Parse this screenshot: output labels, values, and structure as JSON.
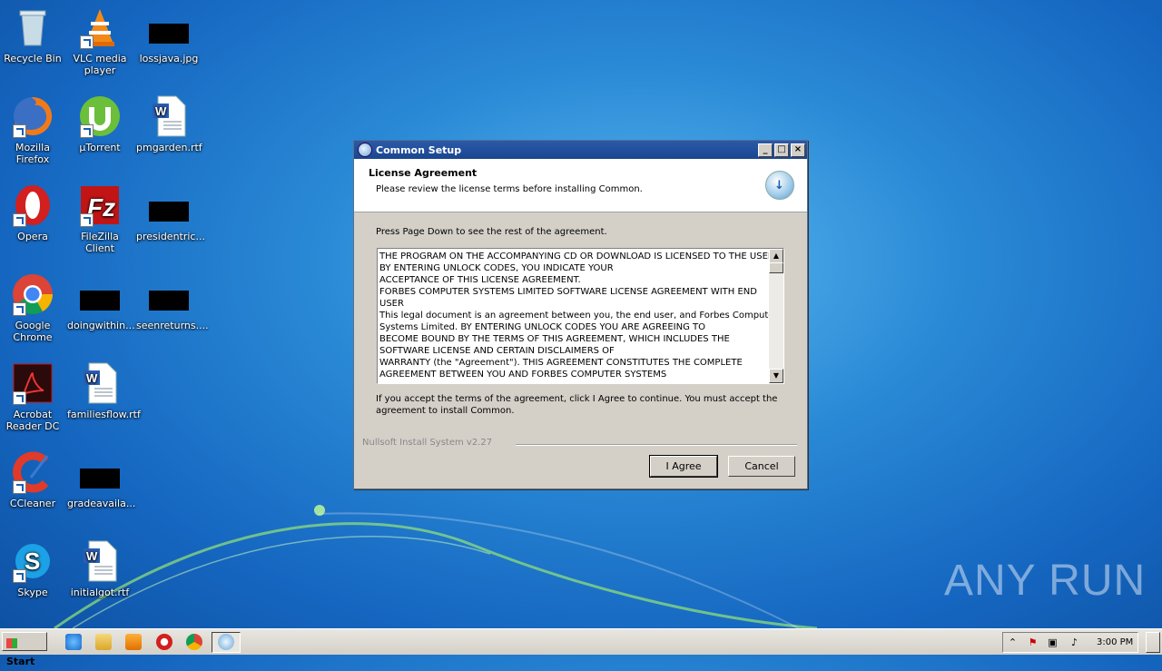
{
  "desktop": {
    "icons": [
      {
        "label": "Recycle Bin",
        "icon": "recycle-bin-icon"
      },
      {
        "label": "VLC media player",
        "icon": "vlc-icon"
      },
      {
        "label": "lossjava.jpg",
        "icon": "redacted-file-icon"
      },
      {
        "label": "Mozilla Firefox",
        "icon": "firefox-icon"
      },
      {
        "label": "µTorrent",
        "icon": "utorrent-icon"
      },
      {
        "label": "pmgarden.rtf",
        "icon": "word-document-icon"
      },
      {
        "label": "Opera",
        "icon": "opera-icon"
      },
      {
        "label": "FileZilla Client",
        "icon": "filezilla-icon"
      },
      {
        "label": "presidentric...",
        "icon": "redacted-file-icon"
      },
      {
        "label": "Google Chrome",
        "icon": "chrome-icon"
      },
      {
        "label": "doingwithin...",
        "icon": "redacted-file-icon"
      },
      {
        "label": "seenreturns....",
        "icon": "redacted-file-icon"
      },
      {
        "label": "Acrobat Reader DC",
        "icon": "acrobat-icon"
      },
      {
        "label": "familiesflow.rtf",
        "icon": "word-document-icon"
      },
      {
        "label": "CCleaner",
        "icon": "ccleaner-icon"
      },
      {
        "label": "gradeavaila...",
        "icon": "redacted-file-icon"
      },
      {
        "label": "Skype",
        "icon": "skype-icon"
      },
      {
        "label": "initialgot.rtf",
        "icon": "word-document-icon"
      }
    ]
  },
  "dialog": {
    "title": "Common Setup",
    "header_title": "License Agreement",
    "header_subtitle": "Please review the license terms before installing Common.",
    "instruction": "Press Page Down to see the rest of the agreement.",
    "license_lines": [
      "THE PROGRAM ON THE ACCOMPANYING CD OR DOWNLOAD IS LICENSED TO THE USER",
      "BY ENTERING UNLOCK CODES, YOU INDICATE YOUR",
      "ACCEPTANCE OF THIS LICENSE AGREEMENT.",
      "FORBES COMPUTER SYSTEMS LIMITED SOFTWARE LICENSE AGREEMENT WITH END",
      "USER",
      "This legal document is an agreement between you, the end user, and Forbes Computer",
      "Systems Limited. BY ENTERING UNLOCK CODES YOU ARE AGREEING TO",
      "BECOME BOUND BY THE TERMS OF THIS AGREEMENT, WHICH INCLUDES THE",
      "SOFTWARE LICENSE AND CERTAIN DISCLAIMERS OF",
      "WARRANTY (the \"Agreement\"). THIS AGREEMENT CONSTITUTES THE COMPLETE",
      "AGREEMENT BETWEEN YOU AND FORBES COMPUTER SYSTEMS"
    ],
    "accept_text_1": "If you accept the terms of the agreement, click I Agree to continue. You must accept the",
    "accept_text_2": "agreement to install Common.",
    "branding": "Nullsoft Install System v2.27",
    "agree_label": "I Agree",
    "cancel_label": "Cancel"
  },
  "taskbar": {
    "start_label": "Start",
    "clock": "3:00 PM"
  },
  "watermark": "ANY RUN"
}
